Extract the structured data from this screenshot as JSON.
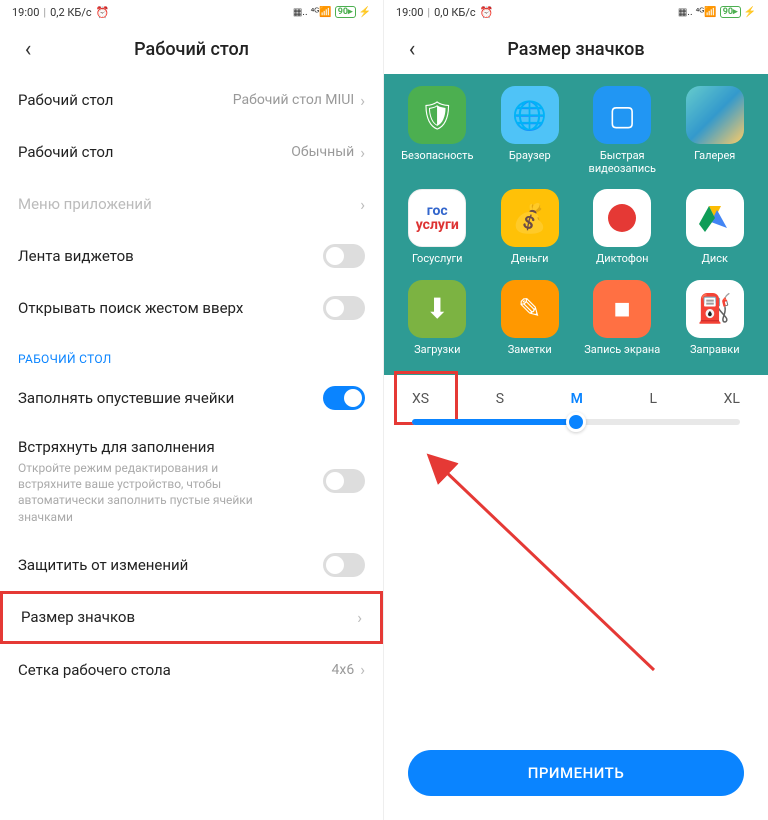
{
  "left": {
    "status": {
      "time": "19:00",
      "speed": "0,2 КБ/с",
      "battery": "90"
    },
    "title": "Рабочий стол",
    "rows": {
      "launcher": {
        "label": "Рабочий стол",
        "value": "Рабочий стол MIUI"
      },
      "style": {
        "label": "Рабочий стол",
        "value": "Обычный"
      },
      "appmenu": {
        "label": "Меню приложений"
      },
      "widgets": {
        "label": "Лента виджетов"
      },
      "searchUp": {
        "label": "Открывать поиск жестом вверх"
      }
    },
    "section": "РАБОЧИЙ СТОЛ",
    "rows2": {
      "fillEmpty": {
        "label": "Заполнять опустевшие ячейки"
      },
      "shake": {
        "label": "Встряхнуть для заполнения",
        "desc": "Откройте режим редактирования и встряхните ваше устройство, чтобы автоматически заполнить пустые ячейки значками"
      },
      "lock": {
        "label": "Защитить от изменений"
      },
      "iconSize": {
        "label": "Размер значков"
      },
      "grid": {
        "label": "Сетка рабочего стола",
        "value": "4x6"
      }
    }
  },
  "right": {
    "status": {
      "time": "19:00",
      "speed": "0,0 КБ/с",
      "battery": "90"
    },
    "title": "Размер значков",
    "apps": [
      {
        "name": "Безопасность"
      },
      {
        "name": "Браузер"
      },
      {
        "name": "Быстрая видеозапись"
      },
      {
        "name": "Галерея"
      },
      {
        "name": "Госуслуги"
      },
      {
        "name": "Деньги"
      },
      {
        "name": "Диктофон"
      },
      {
        "name": "Диск"
      },
      {
        "name": "Загрузки"
      },
      {
        "name": "Заметки"
      },
      {
        "name": "Запись экрана"
      },
      {
        "name": "Заправки"
      }
    ],
    "sizes": {
      "xs": "XS",
      "s": "S",
      "m": "M",
      "l": "L",
      "xl": "XL"
    },
    "apply": "ПРИМЕНИТЬ"
  }
}
